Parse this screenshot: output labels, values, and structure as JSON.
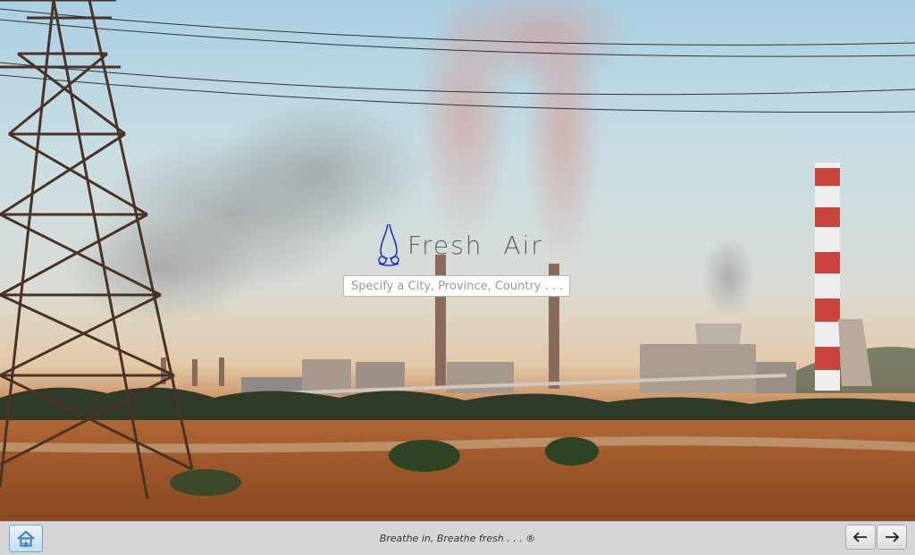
{
  "app": {
    "logo_text": "Fresh  Air"
  },
  "search": {
    "placeholder": "Specify a City, Province, Country . . ."
  },
  "statusbar": {
    "tagline": "Breathe in, Breathe fresh . . . ®",
    "home_icon": "home-icon",
    "back_icon": "arrow-left-icon",
    "forward_icon": "arrow-right-icon"
  },
  "colors": {
    "accent": "#5fa7dc",
    "logo_icon": "#2233cc"
  }
}
